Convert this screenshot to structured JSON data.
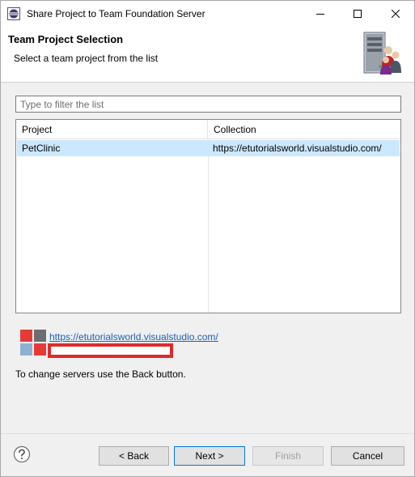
{
  "window": {
    "title": "Share Project to Team Foundation Server",
    "app_icon": "eclipse-icon",
    "controls": [
      "minimize-icon",
      "maximize-icon",
      "close-icon"
    ]
  },
  "banner": {
    "title": "Team Project Selection",
    "subtitle": "Select a team project from the list",
    "graphic": "server-users-icon"
  },
  "filter": {
    "placeholder": "Type to filter the list",
    "value": ""
  },
  "table": {
    "columns": [
      "Project",
      "Collection"
    ],
    "rows": [
      {
        "project": "PetClinic",
        "collection": "https://etutorialsworld.visualstudio.com/",
        "selected": true
      }
    ]
  },
  "server": {
    "logo": "visual-studio-online-icon",
    "url": "https://etutorialsworld.visualstudio.com/",
    "redacted_color": "#e02a2a"
  },
  "hint": "To change servers use the Back button.",
  "footer": {
    "help_icon": "help-icon",
    "back": "< Back",
    "next": "Next >",
    "finish": "Finish",
    "cancel": "Cancel"
  },
  "colors": {
    "selection": "#cce8ff",
    "link": "#1a5fb4",
    "focus_border": "#0078d7"
  }
}
